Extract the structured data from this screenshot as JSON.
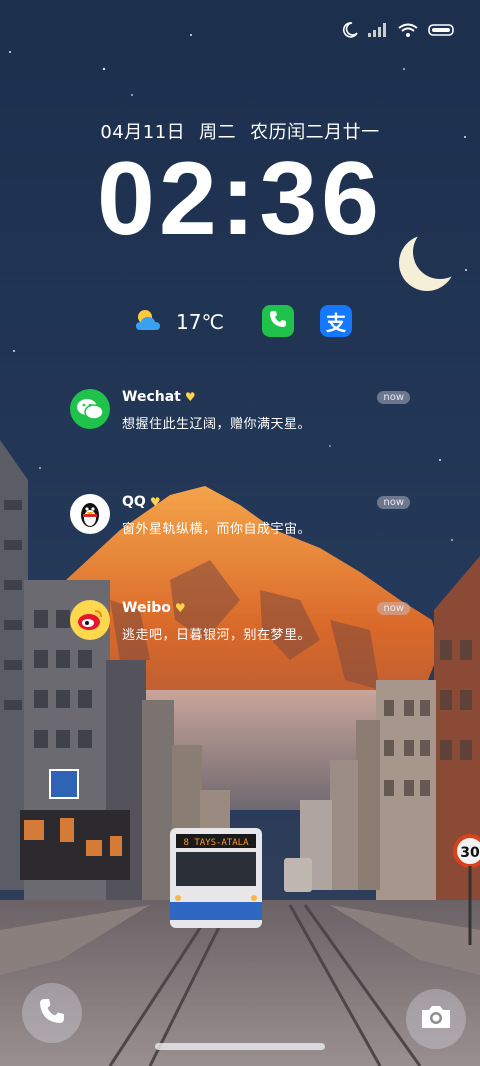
{
  "lockscreen": {
    "date": "04月11日",
    "weekday": "周二",
    "lunar": "农历闰二月廿一",
    "time": "02:36"
  },
  "widgets": {
    "weather_icon": "partly-cloudy-icon",
    "temperature": "17℃",
    "apps": [
      {
        "name": "phone",
        "icon": "phone-icon",
        "color": "#1fc24a"
      },
      {
        "name": "alipay",
        "icon": "alipay-icon",
        "glyph": "支",
        "color": "#1677ff"
      }
    ]
  },
  "notifications": [
    {
      "app": "Wechat",
      "time": "now",
      "message": "想握住此生辽阔，赠你满天星。",
      "icon": "wechat-icon",
      "color": "#1fc24a"
    },
    {
      "app": "QQ",
      "time": "now",
      "message": "窗外星轨纵横，而你自成宇宙。",
      "icon": "qq-penguin-icon",
      "color": "#ffffff"
    },
    {
      "app": "Weibo",
      "time": "now",
      "message": "逃走吧，日暮银河，别在梦里。",
      "icon": "weibo-icon",
      "color": "#ffd84d"
    }
  ],
  "status_bar": {
    "icons": [
      "moon-icon",
      "signal-icon",
      "wifi-icon",
      "battery-icon"
    ]
  },
  "shortcuts": {
    "left": "phone-icon",
    "right": "camera-icon"
  },
  "wallpaper": {
    "sky_color": "#1f3352",
    "mountain_color": "#e07a2c",
    "bus_sign": "8 TAYS-ATALA",
    "speed_sign": "30"
  }
}
